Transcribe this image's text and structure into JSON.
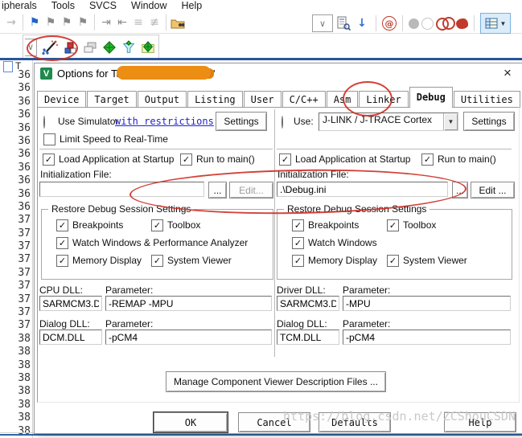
{
  "menu": {
    "items": [
      "ipherals",
      "Tools",
      "SVCS",
      "Window",
      "Help"
    ]
  },
  "editor": {
    "tab_letter": "T",
    "line_numbers": [
      "36",
      "36",
      "36",
      "36",
      "36",
      "36",
      "36",
      "36",
      "36",
      "36",
      "36",
      "37",
      "37",
      "37",
      "37",
      "37",
      "37",
      "37",
      "37",
      "37",
      "38",
      "38",
      "38",
      "38",
      "38",
      "38",
      "38",
      "38"
    ]
  },
  "icons": {
    "forward_arrow": "→",
    "bookmark": "⚑",
    "indent_right": "⇥",
    "indent_left": "⇤",
    "comment": "≡",
    "uncomment": "≢",
    "combo_check": "∨",
    "down_arrow": "↓",
    "at_symbol": "@",
    "dropdown_arrow": "▼",
    "close": "×",
    "check": "✓",
    "logo_letter": "V"
  },
  "dialog": {
    "title_prefix": "Options for Target ",
    "title_suffix": "'",
    "tabs": [
      {
        "label": "Device"
      },
      {
        "label": "Target"
      },
      {
        "label": "Output"
      },
      {
        "label": "Listing"
      },
      {
        "label": "User"
      },
      {
        "label": "C/C++"
      },
      {
        "label": "Asm"
      },
      {
        "label": "Linker"
      },
      {
        "label": "Debug",
        "active": true
      },
      {
        "label": "Utilities"
      }
    ],
    "left": {
      "use_simulator": "Use Simulator",
      "with_restrictions": "with restrictions",
      "settings": "Settings",
      "limit_speed": "Limit Speed to Real-Time",
      "load_app": "Load Application at Startup",
      "run_to_main": "Run to main()",
      "init_file_label": "Initialization File:",
      "init_file_value": "",
      "browse": "...",
      "edit": "Edit...",
      "restore_group": {
        "title": "Restore Debug Session Settings",
        "breakpoints": "Breakpoints",
        "toolbox": "Toolbox",
        "watch": "Watch Windows & Performance Analyzer",
        "memory": "Memory Display",
        "system_viewer": "System Viewer"
      },
      "cpu_dll_label": "CPU DLL:",
      "parameter_label": "Parameter:",
      "cpu_dll_value": "SARMCM3.DLL",
      "cpu_param_value": "-REMAP -MPU",
      "dialog_dll_label": "Dialog DLL:",
      "dialog_dll_value": "DCM.DLL",
      "dialog_param_value": "-pCM4"
    },
    "right": {
      "use": "Use:",
      "debugger": "J-LINK / J-TRACE Cortex",
      "settings": "Settings",
      "load_app": "Load Application at Startup",
      "run_to_main": "Run to main()",
      "init_file_label": "Initialization File:",
      "init_file_value": ".\\Debug.ini",
      "browse": "...",
      "edit": "Edit ...",
      "restore_group": {
        "title": "Restore Debug Session Settings",
        "breakpoints": "Breakpoints",
        "toolbox": "Toolbox",
        "watch": "Watch Windows",
        "memory": "Memory Display",
        "system_viewer": "System Viewer"
      },
      "driver_dll_label": "Driver DLL:",
      "parameter_label": "Parameter:",
      "driver_dll_value": "SARMCM3.DLL",
      "driver_param_value": "-MPU",
      "dialog_dll_label": "Dialog DLL:",
      "dialog_dll_value": "TCM.DLL",
      "dialog_param_value": "-pCM4"
    },
    "manage_button": "Manage Component Viewer Description Files ...",
    "buttons": {
      "ok": "OK",
      "cancel": "Cancel",
      "defaults": "Defaults",
      "help": "Help"
    }
  },
  "watermark": "https://blog.csdn.net/ZCShouCSDN",
  "annotation_color": "#cd2d23"
}
